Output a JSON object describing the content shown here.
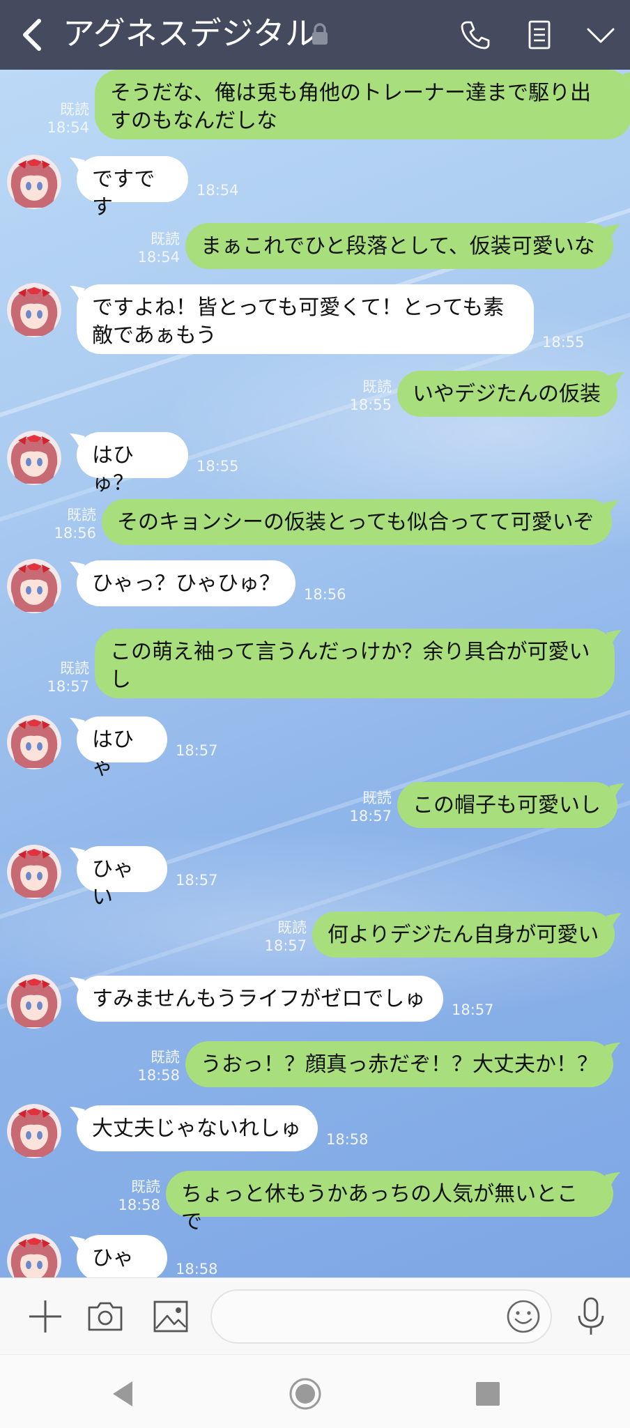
{
  "header": {
    "title": "アグネスデジタル",
    "icons": [
      "back-arrow-icon",
      "lock-icon",
      "phone-icon",
      "notes-icon",
      "chevron-down-icon"
    ]
  },
  "messages": [
    {
      "dir": "out",
      "text": "そうだな、俺は兎も角他のトレーナー達まで駆り出\nすのもなんだしな",
      "read": "既読",
      "time": "18:54"
    },
    {
      "dir": "in",
      "text": "ですです",
      "time": "18:54"
    },
    {
      "dir": "out",
      "text": "まぁこれでひと段落として、仮装可愛いな",
      "read": "既読",
      "time": "18:54"
    },
    {
      "dir": "in",
      "text": "ですよね！皆とっても可愛くて！とっても素\n敵であぁもう",
      "time": "18:55"
    },
    {
      "dir": "out",
      "text": "いやデジたんの仮装",
      "read": "既読",
      "time": "18:55"
    },
    {
      "dir": "in",
      "text": "はひゅ？",
      "time": "18:55"
    },
    {
      "dir": "out",
      "text": "そのキョンシーの仮装とっても似合ってて可愛いぞ",
      "read": "既読",
      "time": "18:56"
    },
    {
      "dir": "in",
      "text": "ひゃっ？ひゃひゅ？",
      "time": "18:56"
    },
    {
      "dir": "out",
      "text": "この萌え袖って言うんだっけか？余り具合が可愛い\nし",
      "read": "既読",
      "time": "18:57"
    },
    {
      "dir": "in",
      "text": "はひゃ",
      "time": "18:57"
    },
    {
      "dir": "out",
      "text": "この帽子も可愛いし",
      "read": "既読",
      "time": "18:57"
    },
    {
      "dir": "in",
      "text": "ひゃい",
      "time": "18:57"
    },
    {
      "dir": "out",
      "text": "何よりデジたん自身が可愛い",
      "read": "既読",
      "time": "18:57"
    },
    {
      "dir": "in",
      "text": "すみませんもうライフがゼロでしゅ",
      "time": "18:57"
    },
    {
      "dir": "out",
      "text": "うおっ！？顔真っ赤だぞ！？大丈夫か！？",
      "read": "既読",
      "time": "18:58"
    },
    {
      "dir": "in",
      "text": "大丈夫じゃないれしゅ",
      "time": "18:58"
    },
    {
      "dir": "out",
      "text": "ちょっと休もうかあっちの人気が無いとこで",
      "read": "既読",
      "time": "18:58"
    },
    {
      "dir": "in",
      "text": "ひゃい",
      "time": "18:58"
    }
  ],
  "input_bar": {
    "placeholder": "",
    "icons": [
      "plus-icon",
      "camera-icon",
      "image-icon",
      "emoji-icon",
      "mic-icon"
    ]
  },
  "colors": {
    "header_bg": "#454b5e",
    "outgoing_bubble": "#a9de7c",
    "incoming_bubble": "#ffffff",
    "chat_bg": "#a9caf0"
  }
}
